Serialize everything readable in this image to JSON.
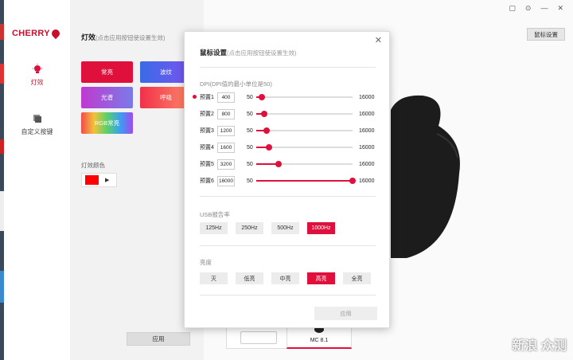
{
  "sidebar": {
    "logo": "CHERRY",
    "items": [
      {
        "label": "灯效",
        "icon": "lightbulb-icon"
      },
      {
        "label": "自定义按键",
        "icon": "keys-icon"
      }
    ]
  },
  "panel": {
    "title": "灯效",
    "hint": "(点击应用按钮使设置生效)",
    "effects": [
      "常亮",
      "波纹",
      "光谱",
      "呼吸",
      "RGB常亮"
    ],
    "color_label": "灯效颜色",
    "color_value": "#ff0000",
    "apply": "应用"
  },
  "main": {
    "mouse_settings": "鼠标设置",
    "devices": [
      {
        "name": ""
      },
      {
        "name": "MC 8.1"
      }
    ],
    "watermark": "新浪 众测"
  },
  "modal": {
    "title": "鼠标设置",
    "hint": "(点击应用按钮使设置生效)",
    "dpi_label": "DPI(DPI值的最小单位是50)",
    "presets": [
      {
        "name": "预置1",
        "value": "400",
        "min": "50",
        "max": "16000",
        "active": true
      },
      {
        "name": "预置2",
        "value": "800",
        "min": "50",
        "max": "16000"
      },
      {
        "name": "预置3",
        "value": "1200",
        "min": "50",
        "max": "16000"
      },
      {
        "name": "预置4",
        "value": "1600",
        "min": "50",
        "max": "16000"
      },
      {
        "name": "预置5",
        "value": "3200",
        "min": "50",
        "max": "16000"
      },
      {
        "name": "预置6",
        "value": "16000",
        "min": "50",
        "max": "16000"
      }
    ],
    "usb_label": "USB报告率",
    "usb_options": [
      "125Hz",
      "250Hz",
      "500Hz",
      "1000Hz"
    ],
    "usb_selected": "1000Hz",
    "brightness_label": "亮度",
    "brightness_options": [
      "灭",
      "低亮",
      "中亮",
      "高亮",
      "全亮"
    ],
    "brightness_selected": "高亮",
    "apply": "应用"
  },
  "colors": {
    "accent": "#e0103c",
    "brand": "#c8102e"
  }
}
